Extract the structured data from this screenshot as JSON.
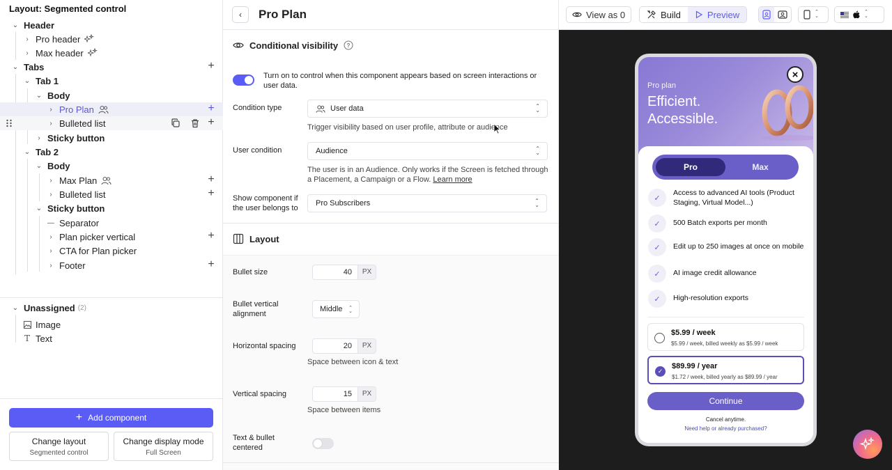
{
  "left": {
    "title": "Layout: Segmented control",
    "tree": {
      "header": "Header",
      "pro_header": "Pro header",
      "max_header": "Max header",
      "tabs": "Tabs",
      "tab1": "Tab 1",
      "body1": "Body",
      "pro_plan": "Pro Plan",
      "bulleted_list1": "Bulleted list",
      "sticky1": "Sticky button",
      "tab2": "Tab 2",
      "body2": "Body",
      "max_plan": "Max Plan",
      "bulleted_list2": "Bulleted list",
      "sticky2": "Sticky button",
      "separator": "Separator",
      "plan_picker": "Plan picker vertical",
      "cta": "CTA for Plan picker",
      "footer": "Footer"
    },
    "unassigned": {
      "label": "Unassigned",
      "count": "(2)",
      "image": "Image",
      "text": "Text"
    },
    "add_component": "Add component",
    "change_layout": {
      "title": "Change layout",
      "value": "Segmented control"
    },
    "change_display": {
      "title": "Change display mode",
      "value": "Full Screen"
    }
  },
  "mid": {
    "title": "Pro Plan",
    "visibility": {
      "heading": "Conditional visibility",
      "toggle_on": true,
      "toggle_text": "Turn on to control when this component appears based on screen interactions or user data.",
      "condition_type_label": "Condition type",
      "condition_type_value": "User data",
      "condition_type_help": "Trigger visibility based on user profile, attribute or audience",
      "user_condition_label": "User condition",
      "user_condition_value": "Audience",
      "user_condition_help": "The user is in an Audience. Only works if the Screen is fetched through a Placement, a Campaign or a Flow.",
      "learn_more": "Learn more",
      "show_if_label": "Show component if the user belongs to",
      "show_if_value": "Pro Subscribers"
    },
    "layout": {
      "heading": "Layout",
      "bullet_size_label": "Bullet size",
      "bullet_size": "40",
      "unit": "PX",
      "bullet_align_label": "Bullet vertical alignment",
      "bullet_align": "Middle",
      "h_spacing_label": "Horizontal spacing",
      "h_spacing": "20",
      "h_spacing_help": "Space between icon & text",
      "v_spacing_label": "Vertical spacing",
      "v_spacing": "15",
      "v_spacing_help": "Space between items",
      "centered_label": "Text & bullet centered",
      "centered_on": false
    }
  },
  "right": {
    "view_as": "View as 0",
    "build": "Build",
    "preview": "Preview",
    "phone": {
      "eyebrow": "Pro plan",
      "headline_1": "Efficient.",
      "headline_2": "Accessible.",
      "tab_pro": "Pro",
      "tab_max": "Max",
      "features": [
        "Access to advanced AI tools (Product Staging, Virtual Model...)",
        "500 Batch exports per month",
        "Edit up to 250 images at once on mobile",
        "AI image credit allowance",
        "High-resolution exports"
      ],
      "price_week_title": "$5.99 / week",
      "price_week_sub": "$5.99 / week, billed weekly as $5.99 / week",
      "price_year_title": "$89.99 / year",
      "price_year_sub": "$1.72 / week, billed yearly as $89.99 / year",
      "continue": "Continue",
      "cancel": "Cancel anytime.",
      "help": "Need help or already purchased?"
    }
  }
}
